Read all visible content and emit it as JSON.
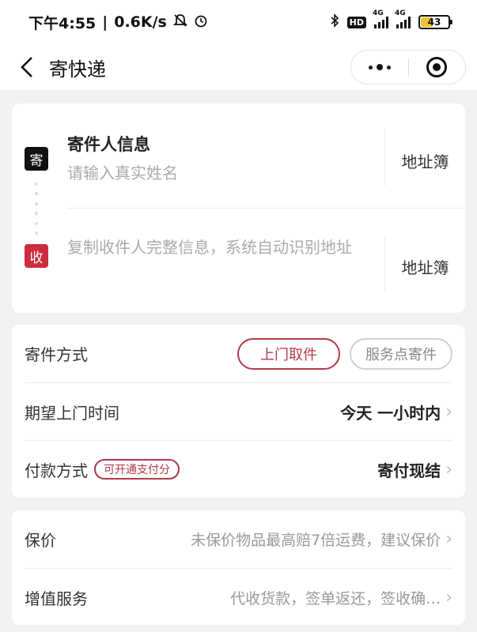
{
  "status_bar": {
    "time": "下午4:55",
    "speed": "0.6K/s",
    "hd": "HD",
    "net1": "4G",
    "net2": "4G",
    "battery": "43"
  },
  "nav": {
    "title": "寄快递"
  },
  "sender": {
    "badge": "寄",
    "title": "寄件人信息",
    "placeholder": "请输入真实姓名",
    "address_book": "地址簿"
  },
  "recipient": {
    "badge": "收",
    "placeholder": "复制收件人完整信息，系统自动识别地址",
    "address_book": "地址簿"
  },
  "options": {
    "method_label": "寄件方式",
    "method_active": "上门取件",
    "method_other": "服务点寄件",
    "time_label": "期望上门时间",
    "time_value": "今天 一小时内",
    "payment_label": "付款方式",
    "payment_tag": "可开通支付分",
    "payment_value": "寄付现结"
  },
  "extras": {
    "insurance_label": "保价",
    "insurance_value": "未保价物品最高赔7倍运费，建议保价",
    "service_label": "增值服务",
    "service_value": "代收货款，签单返还，签收确…"
  },
  "colors": {
    "accent": "#b23a48",
    "recv_badge": "#cd2d3c",
    "battery": "#f2c230"
  }
}
